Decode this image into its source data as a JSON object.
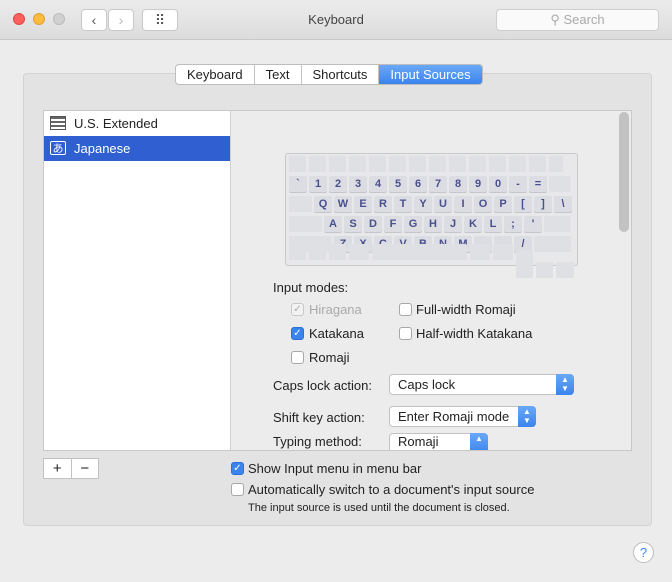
{
  "window": {
    "title": "Keyboard",
    "search_placeholder": "Search",
    "back": "‹",
    "forward": "›",
    "grid": "⠿"
  },
  "tabs": [
    {
      "label": "Keyboard"
    },
    {
      "label": "Text"
    },
    {
      "label": "Shortcuts"
    },
    {
      "label": "Input Sources",
      "selected": true
    }
  ],
  "sources": [
    {
      "label": "U.S. Extended",
      "icon": "flag-us"
    },
    {
      "label": "Japanese",
      "icon": "あ",
      "selected": true
    }
  ],
  "keyboard": {
    "row1": [
      "`",
      "1",
      "2",
      "3",
      "4",
      "5",
      "6",
      "7",
      "8",
      "9",
      "0",
      "-",
      "="
    ],
    "row2": [
      "Q",
      "W",
      "E",
      "R",
      "T",
      "Y",
      "U",
      "I",
      "O",
      "P",
      "[",
      "]",
      "\\"
    ],
    "row3": [
      "A",
      "S",
      "D",
      "F",
      "G",
      "H",
      "J",
      "K",
      "L",
      ";",
      "'"
    ],
    "row4": [
      "Z",
      "X",
      "C",
      "V",
      "B",
      "N",
      "M",
      ",",
      ".",
      "/"
    ]
  },
  "input_modes": {
    "label": "Input modes:",
    "items": [
      {
        "label": "Hiragana",
        "checked": true,
        "disabled": true
      },
      {
        "label": "Full-width Romaji",
        "checked": false
      },
      {
        "label": "Katakana",
        "checked": true
      },
      {
        "label": "Half-width Katakana",
        "checked": false
      },
      {
        "label": "Romaji",
        "checked": false
      }
    ]
  },
  "caps_lock": {
    "label": "Caps lock action:",
    "value": "Caps lock"
  },
  "shift_key": {
    "label": "Shift key action:",
    "value": "Enter Romaji mode"
  },
  "typing_method": {
    "label": "Typing method:",
    "value": "Romaji"
  },
  "list_controls": {
    "add": "+",
    "remove": "−"
  },
  "show_menu": {
    "label": "Show Input menu in menu bar",
    "checked": true
  },
  "auto_switch": {
    "label": "Automatically switch to a document's input source",
    "checked": false,
    "note": "The input source is used until the document is closed."
  },
  "help": "?"
}
